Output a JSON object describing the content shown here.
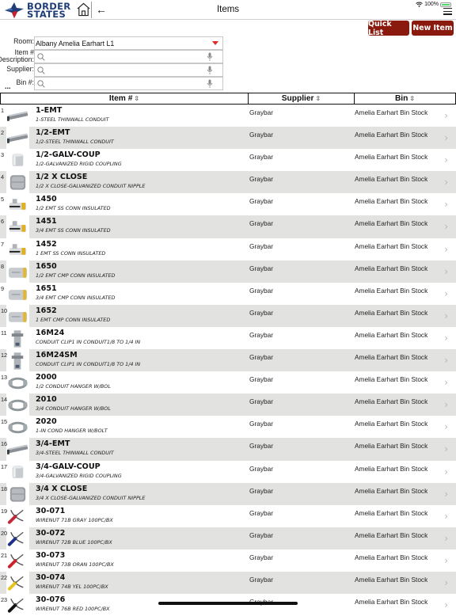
{
  "header": {
    "brand_line1": "BORDER",
    "brand_line2": "STATES",
    "title": "Items",
    "battery_text": "100%",
    "battery_level": 1.0
  },
  "actions": {
    "quick_list": "Quick List",
    "new_item": "New Item"
  },
  "filters": {
    "room_label": "Room:",
    "room_value": "Albany Amelia Earhart L1",
    "item_label_line1": "Item #",
    "item_label_line2": "Description:",
    "supplier_label": "Supplier:",
    "bin_label": "Bin #:",
    "more": "..."
  },
  "table": {
    "columns": [
      "Item #",
      "Supplier",
      "Bin"
    ],
    "sort_icon": "⇳",
    "rows": [
      {
        "n": "1",
        "code": "1-EMT",
        "desc": "1-STEEL THINWALL CONDUIT",
        "supplier": "Graybar",
        "bin": "Amelia Earhart Bin Stock",
        "img": "conduit"
      },
      {
        "n": "2",
        "code": "1/2-EMT",
        "desc": "1/2-STEEL THINWALL CONDUIT",
        "supplier": "Graybar",
        "bin": "Amelia Earhart Bin Stock",
        "img": "conduit"
      },
      {
        "n": "3",
        "code": "1/2-GALV-COUP",
        "desc": "1/2-GALVANIZED RIGID COUPLING",
        "supplier": "Graybar",
        "bin": "Amelia Earhart Bin Stock",
        "img": "coupling"
      },
      {
        "n": "4",
        "code": "1/2 X CLOSE",
        "desc": "1/2 X CLOSE-GALVANIZED CONDUIT NIPPLE",
        "supplier": "Graybar",
        "bin": "Amelia Earhart Bin Stock",
        "img": "nipple"
      },
      {
        "n": "5",
        "code": "1450",
        "desc": "1/2 EMT SS CONN INSULATED",
        "supplier": "Graybar",
        "bin": "Amelia Earhart Bin Stock",
        "img": "connector"
      },
      {
        "n": "6",
        "code": "1451",
        "desc": "3/4 EMT SS CONN INSULATED",
        "supplier": "Graybar",
        "bin": "Amelia Earhart Bin Stock",
        "img": "connector"
      },
      {
        "n": "7",
        "code": "1452",
        "desc": "1 EMT SS CONN INSULATED",
        "supplier": "Graybar",
        "bin": "Amelia Earhart Bin Stock",
        "img": "connector"
      },
      {
        "n": "8",
        "code": "1650",
        "desc": "1/2 EMT CMP CONN INSULATED",
        "supplier": "Graybar",
        "bin": "Amelia Earhart Bin Stock",
        "img": "cmp"
      },
      {
        "n": "9",
        "code": "1651",
        "desc": "3/4 EMT CMP CONN INSULATED",
        "supplier": "Graybar",
        "bin": "Amelia Earhart Bin Stock",
        "img": "cmp"
      },
      {
        "n": "10",
        "code": "1652",
        "desc": "1 EMT CMP CONN INSULATED",
        "supplier": "Graybar",
        "bin": "Amelia Earhart Bin Stock",
        "img": "cmp"
      },
      {
        "n": "11",
        "code": "16M24",
        "desc": "CONDUIT CLIP1 IN CONDUIT1/8 TO 1/4 IN",
        "supplier": "Graybar",
        "bin": "Amelia Earhart Bin Stock",
        "img": "clip"
      },
      {
        "n": "12",
        "code": "16M24SM",
        "desc": "CONDUIT CLIP1 IN CONDUIT1/8 TO 1/4 IN",
        "supplier": "Graybar",
        "bin": "Amelia Earhart Bin Stock",
        "img": "clip"
      },
      {
        "n": "13",
        "code": "2000",
        "desc": "1/2 CONDUIT HANGER W/BOL",
        "supplier": "Graybar",
        "bin": "Amelia Earhart Bin Stock",
        "img": "hanger"
      },
      {
        "n": "14",
        "code": "2010",
        "desc": "3/4 CONDUIT HANGER W/BOL",
        "supplier": "Graybar",
        "bin": "Amelia Earhart Bin Stock",
        "img": "hanger"
      },
      {
        "n": "15",
        "code": "2020",
        "desc": "1-IN COND HANGER W/BOLT",
        "supplier": "Graybar",
        "bin": "Amelia Earhart Bin Stock",
        "img": "hanger"
      },
      {
        "n": "16",
        "code": "3/4-EMT",
        "desc": "3/4-STEEL THINWALL CONDUIT",
        "supplier": "Graybar",
        "bin": "Amelia Earhart Bin Stock",
        "img": "conduit"
      },
      {
        "n": "17",
        "code": "3/4-GALV-COUP",
        "desc": "3/4-GALVANIZED RIGID COUPLING",
        "supplier": "Graybar",
        "bin": "Amelia Earhart Bin Stock",
        "img": "coupling"
      },
      {
        "n": "18",
        "code": "3/4 X CLOSE",
        "desc": "3/4 X CLOSE-GALVANIZED CONDUIT NIPPLE",
        "supplier": "Graybar",
        "bin": "Amelia Earhart Bin Stock",
        "img": "nipple"
      },
      {
        "n": "19",
        "code": "30-071",
        "desc": "WIRENUT 71B GRAY 100PC/BX",
        "supplier": "Graybar",
        "bin": "Amelia Earhart Bin Stock",
        "img": "wirenut",
        "color": "#c0283a"
      },
      {
        "n": "20",
        "code": "30-072",
        "desc": "WIRENUT 72B BLUE 100PC/BX",
        "supplier": "Graybar",
        "bin": "Amelia Earhart Bin Stock",
        "img": "wirenut",
        "color": "#1e2f8a"
      },
      {
        "n": "21",
        "code": "30-073",
        "desc": "WIRENUT 73B ORAN 100PC/BX",
        "supplier": "Graybar",
        "bin": "Amelia Earhart Bin Stock",
        "img": "wirenut",
        "color": "#d0202a"
      },
      {
        "n": "22",
        "code": "30-074",
        "desc": "WIRENUT 74B YEL 100PC/BX",
        "supplier": "Graybar",
        "bin": "Amelia Earhart Bin Stock",
        "img": "wirenut",
        "color": "#e8c21a"
      },
      {
        "n": "23",
        "code": "30-076",
        "desc": "WIRENUT 76B RED 100PC/BX",
        "supplier": "Graybar",
        "bin": "Amelia Earhart Bin Stock",
        "img": "wirenut",
        "color": "#111111"
      }
    ]
  },
  "colors": {
    "brand_navy": "#1f3e79",
    "brand_red": "#c8202f",
    "button_bg": "#8b1a0e",
    "row_alt": "#e2e2e0"
  }
}
